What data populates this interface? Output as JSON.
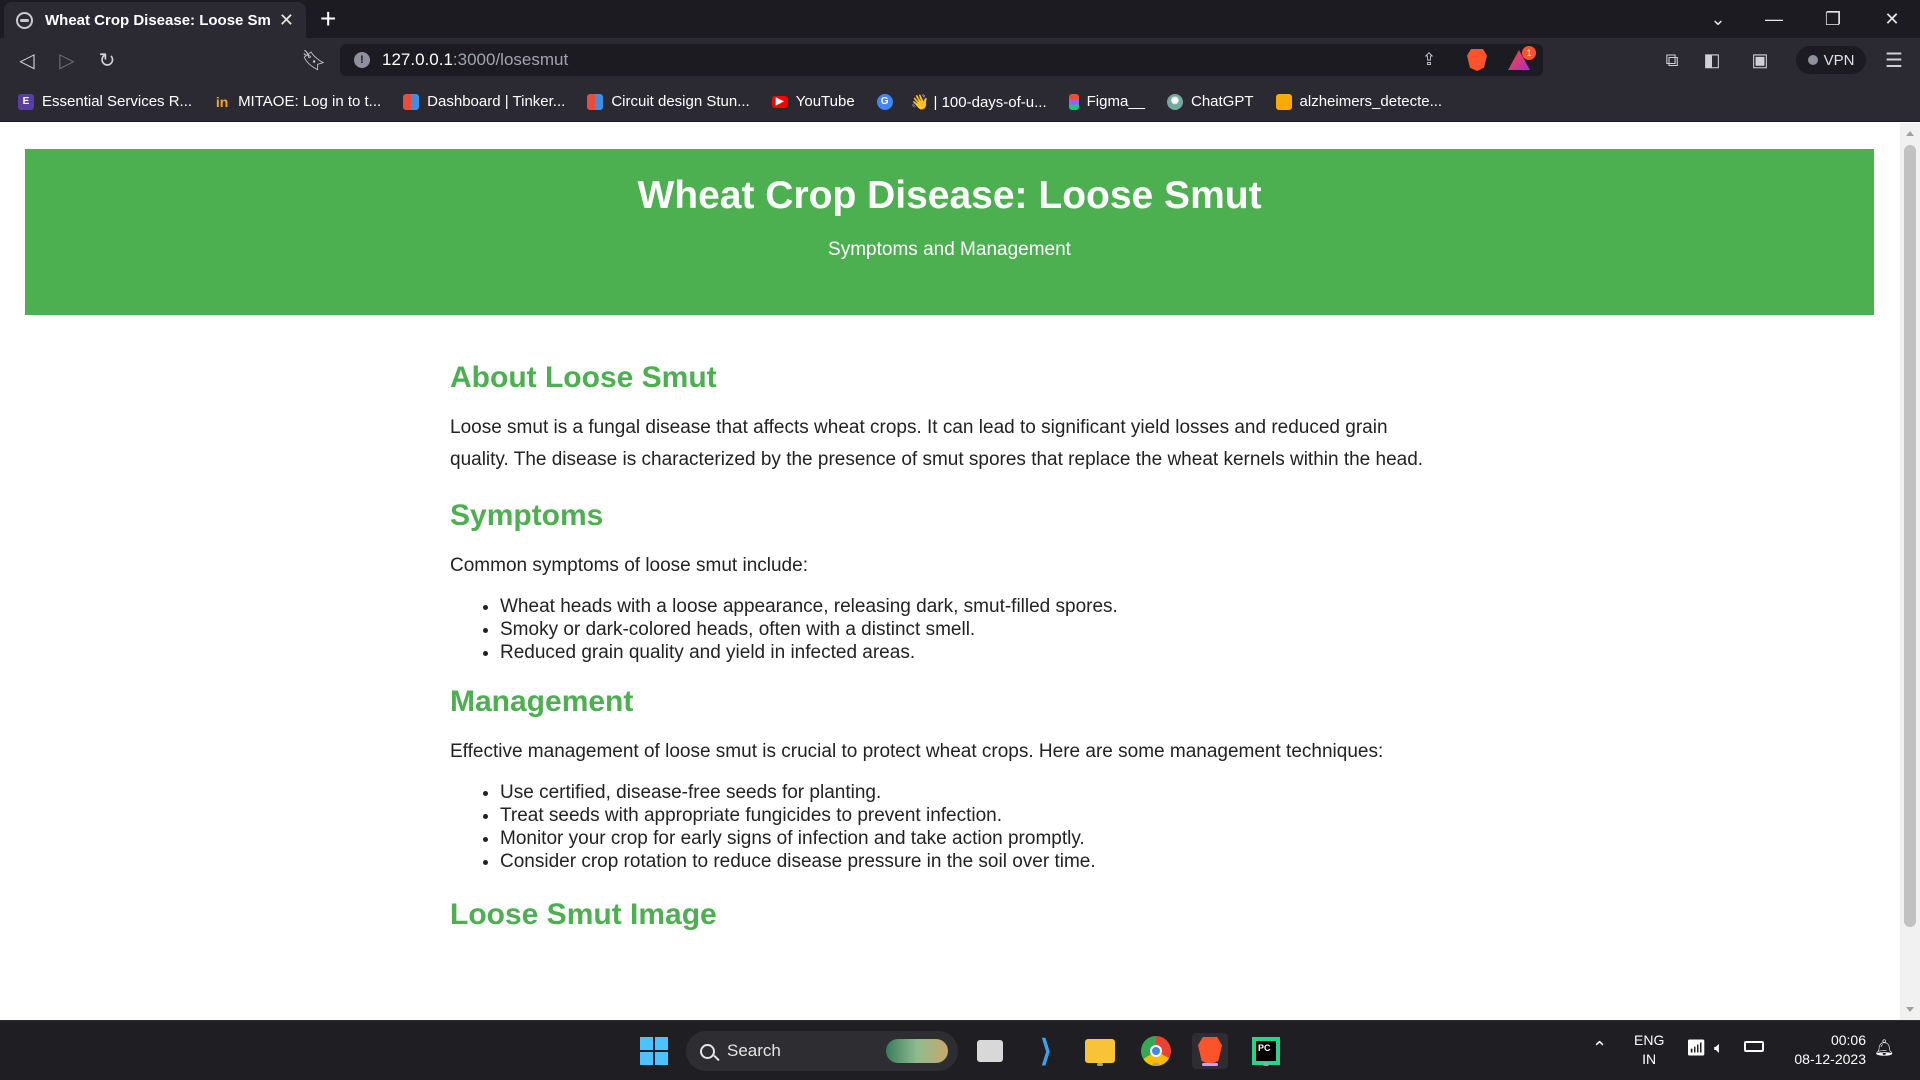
{
  "browser": {
    "tab_title": "Wheat Crop Disease: Loose Smut",
    "url_host": "127.0.0.1",
    "url_path": ":3000/losesmut",
    "shields_badge": "1",
    "vpn_label": "VPN"
  },
  "bookmarks": [
    {
      "label": "Essential Services R...",
      "icon": "ess-icon",
      "color": "#5a3fa0"
    },
    {
      "label": "MITAOE: Log in to t...",
      "icon": "mitaoe-icon",
      "color": "#f5a623"
    },
    {
      "label": "Dashboard | Tinker...",
      "icon": "tinkercad-icon",
      "color": "#e84d3d"
    },
    {
      "label": "Circuit design Stun...",
      "icon": "tinkercad-icon",
      "color": "#e84d3d"
    },
    {
      "label": "YouTube",
      "icon": "youtube-icon",
      "color": "#ff0000"
    },
    {
      "label": "",
      "icon": "google-icon",
      "color": "#4285f4"
    },
    {
      "label": "👋 | 100-days-of-u...",
      "icon": "wave-icon",
      "color": "#2b2a33"
    },
    {
      "label": "Figma__",
      "icon": "figma-icon",
      "color": "#a259ff"
    },
    {
      "label": "ChatGPT",
      "icon": "chatgpt-icon",
      "color": "#74aa9c"
    },
    {
      "label": "alzheimers_detecte...",
      "icon": "colab-icon",
      "color": "#f9ab00"
    }
  ],
  "page": {
    "header_title": "Wheat Crop Disease: Loose Smut",
    "header_subtitle": "Symptoms and Management",
    "about_heading": "About Loose Smut",
    "about_text": "Loose smut is a fungal disease that affects wheat crops. It can lead to significant yield losses and reduced grain quality. The disease is characterized by the presence of smut spores that replace the wheat kernels within the head.",
    "symptoms_heading": "Symptoms",
    "symptoms_intro": "Common symptoms of loose smut include:",
    "symptoms": [
      "Wheat heads with a loose appearance, releasing dark, smut-filled spores.",
      "Smoky or dark-colored heads, often with a distinct smell.",
      "Reduced grain quality and yield in infected areas."
    ],
    "management_heading": "Management",
    "management_intro": "Effective management of loose smut is crucial to protect wheat crops. Here are some management techniques:",
    "management": [
      "Use certified, disease-free seeds for planting.",
      "Treat seeds with appropriate fungicides to prevent infection.",
      "Monitor your crop for early signs of infection and take action promptly.",
      "Consider crop rotation to reduce disease pressure in the soil over time."
    ],
    "image_heading": "Loose Smut Image",
    "accent_color": "#4caf50"
  },
  "taskbar": {
    "search_label": "Search",
    "lang_top": "ENG",
    "lang_bottom": "IN",
    "time": "00:06",
    "date": "08-12-2023"
  }
}
